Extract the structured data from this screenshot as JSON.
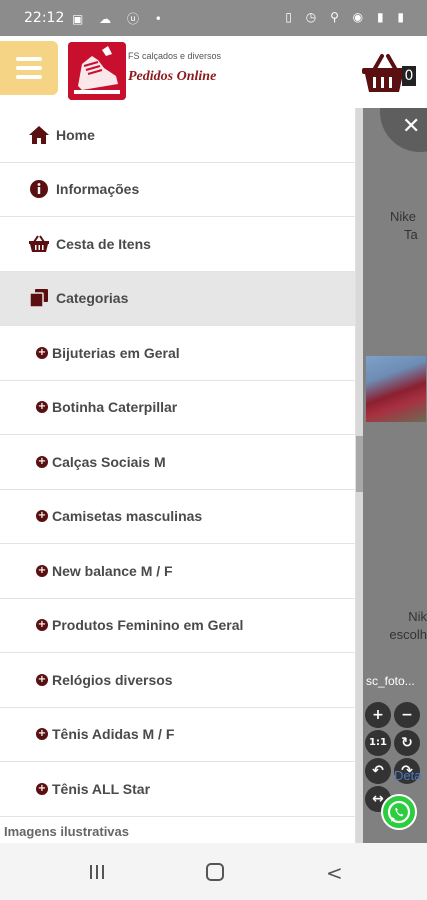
{
  "status_bar": {
    "time": "22:12",
    "left_icons": [
      "gallery-icon",
      "cloud-icon",
      "circle-notification-icon",
      "dot-icon"
    ],
    "right_icons": [
      "vibrate-icon",
      "alarm-icon",
      "location-icon",
      "wifi-icon",
      "signal-icon",
      "battery-icon"
    ]
  },
  "header": {
    "brand_top": "FS calçados e diversos",
    "brand_main": "Pedidos Online",
    "cart_count": "0"
  },
  "menu": {
    "items": [
      {
        "label": "Home",
        "icon": "home-icon"
      },
      {
        "label": "Informações",
        "icon": "info-icon"
      },
      {
        "label": "Cesta de Itens",
        "icon": "basket-icon"
      },
      {
        "label": "Categorias",
        "icon": "copy-icon"
      }
    ],
    "categories": [
      {
        "label": "Bijuterias em Geral"
      },
      {
        "label": "Botinha Caterpillar"
      },
      {
        "label": "Calças Sociais M"
      },
      {
        "label": "Camisetas masculinas"
      },
      {
        "label": "New balance M / F"
      },
      {
        "label": "Produtos Feminino em Geral"
      },
      {
        "label": "Relógios diversos"
      },
      {
        "label": "Tênis Adidas M / F"
      },
      {
        "label": "Tênis ALL Star"
      }
    ]
  },
  "footer_text": "Imagens ilustrativas",
  "background": {
    "text1_line1": "Nike",
    "text1_line2": "Ta",
    "text2_line1": "Nik",
    "text2_line2": "escolh",
    "caption": "sc_foto...",
    "link": "Deta",
    "zoom_controls": [
      "+",
      "−",
      "1:1",
      "↻",
      "↶",
      "↷",
      "↔",
      "↕"
    ]
  },
  "colors": {
    "accent_menu_button": "#f5d485",
    "brand_dark_red": "#5a1010",
    "logo_red": "#c8102e"
  }
}
